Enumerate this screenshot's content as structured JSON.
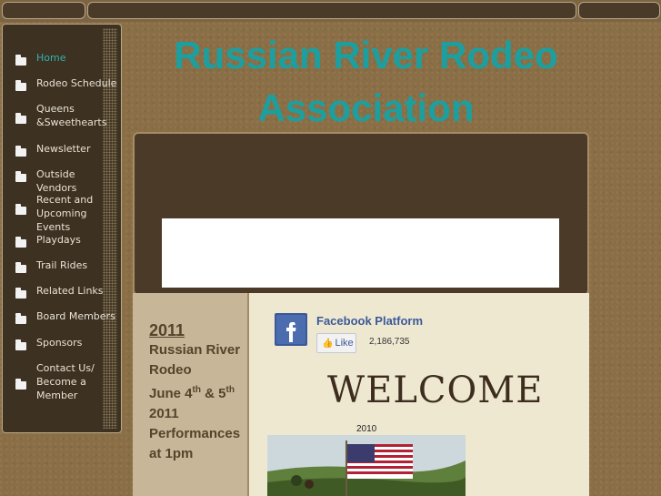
{
  "site": {
    "title": "Russian River Rodeo Association"
  },
  "sidebar": {
    "items": [
      {
        "label": "Home",
        "active": true
      },
      {
        "label": "Rodeo Schedule",
        "active": false
      },
      {
        "label": "Queens &Sweethearts",
        "active": false
      },
      {
        "label": "Newsletter",
        "active": false
      },
      {
        "label": "Outside Vendors",
        "active": false
      },
      {
        "label": "Recent and Upcoming Events",
        "active": false
      },
      {
        "label": "Playdays",
        "active": false
      },
      {
        "label": "Trail Rides",
        "active": false
      },
      {
        "label": "Related Links",
        "active": false
      },
      {
        "label": "Board Members",
        "active": false
      },
      {
        "label": "Sponsors",
        "active": false
      },
      {
        "label": "Contact Us/ Become a Member",
        "active": false
      }
    ]
  },
  "event": {
    "year": "2011",
    "name_line1": "Russian River",
    "name_line2": "Rodeo",
    "date_prefix": "June 4",
    "date_sup1": "th",
    "date_mid": " & 5",
    "date_sup2": "th",
    "date_year": "2011",
    "perf_line1": "Performances",
    "perf_line2": "at 1pm"
  },
  "facebook": {
    "title": "Facebook Platform",
    "like_label": "Like",
    "count": "2,186,735"
  },
  "welcome": {
    "heading": "WELCOME",
    "photo_year": "2010"
  },
  "colors": {
    "title": "#1c9f9e",
    "active_nav": "#2fb3b0",
    "page_bg": "#8a6e46",
    "panel_bg": "#3d3121"
  }
}
